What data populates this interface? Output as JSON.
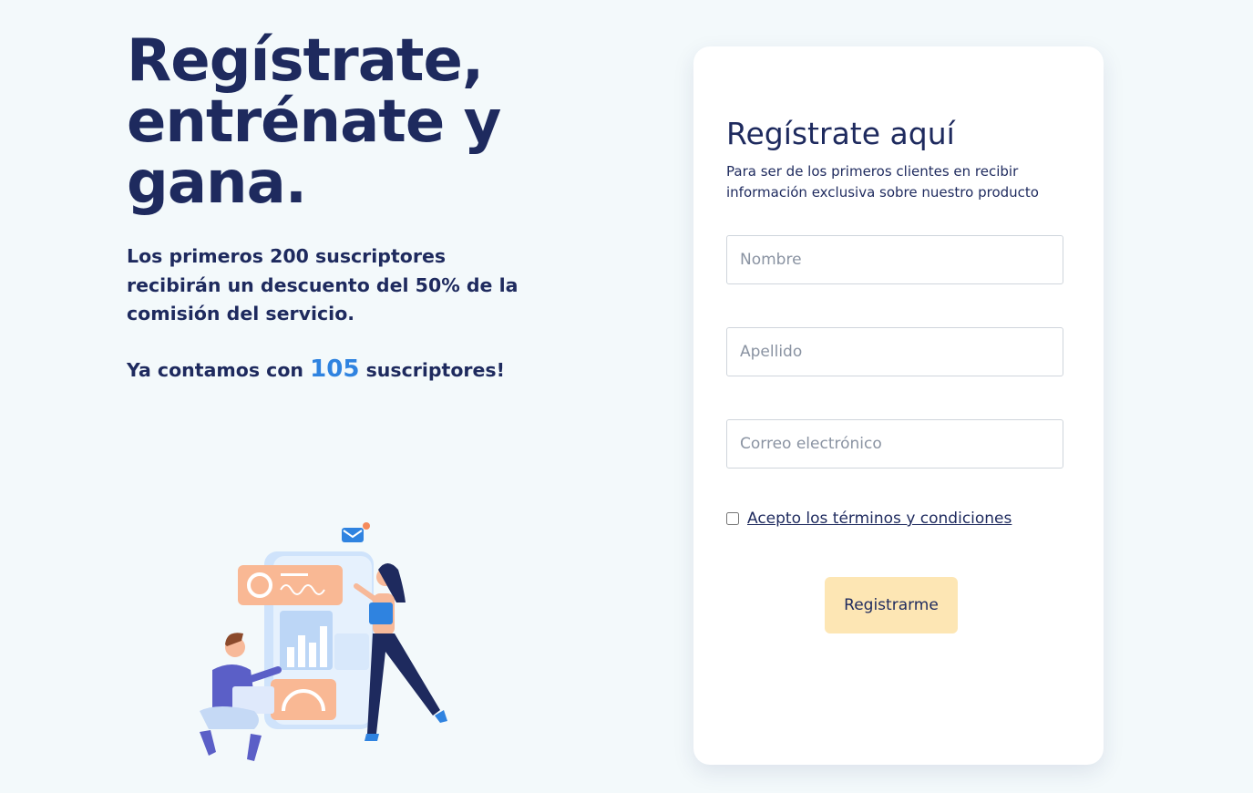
{
  "hero": {
    "title_line1": "Regístrate,",
    "title_line2": "entrénate y",
    "title_line3": "gana.",
    "promo": "Los primeros 200 suscriptores recibirán un descuento del 50% de la comisión del servicio.",
    "count_prefix": "Ya contamos con ",
    "count_value": "105",
    "count_suffix": " suscriptores!"
  },
  "form": {
    "title": "Regístrate aquí",
    "subtitle": "Para ser de los primeros clientes en recibir información exclusiva sobre nuestro producto",
    "first_name_placeholder": "Nombre",
    "last_name_placeholder": "Apellido",
    "email_placeholder": "Correo electrónico",
    "terms_label": "Acepto los términos y condiciones",
    "terms_checked": false,
    "submit_label": "Registrarme"
  },
  "colors": {
    "background": "#f3f9fb",
    "text_primary": "#1e2a5e",
    "accent_blue": "#2f83e0",
    "button_bg": "#fde6b4",
    "illustration_orange": "#f9b894"
  }
}
